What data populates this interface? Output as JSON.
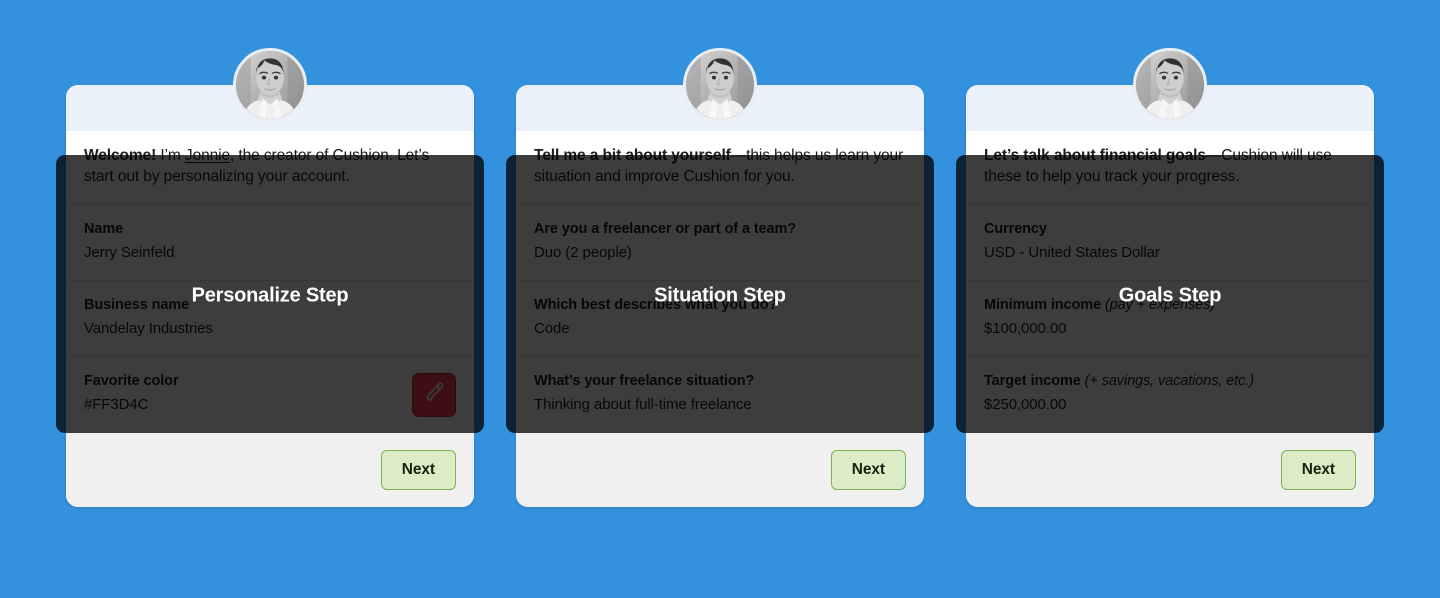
{
  "page": {
    "background_color": "#3391DE",
    "overlay_color": "rgba(0,0,0,0.76)",
    "accent_green": "#7CB254",
    "next_button_fill": "#DBECC7",
    "card_header_color": "#EAF1FA",
    "card_footer_color": "#F0F0F0",
    "overlay_panel_color": "#3C3C3C"
  },
  "cards": [
    {
      "step_label": "Personalize Step",
      "avatar_name": "jonnie-avatar",
      "intro": {
        "bold": "Welcome!",
        "before_link": " I’m ",
        "link": "Jonnie",
        "after_link": ", the creator of Cushion. Let’s start out by personalizing your account."
      },
      "fields": [
        {
          "label": "Name",
          "hint": "",
          "value": "Jerry Seinfeld",
          "swatch": null
        },
        {
          "label": "Business name",
          "hint": "",
          "value": "Vandelay Industries",
          "swatch": null
        },
        {
          "label": "Favorite color",
          "hint": "",
          "value": "#FF3D4C",
          "swatch": "#FF3D4C"
        }
      ],
      "next_label": "Next"
    },
    {
      "step_label": "Situation Step",
      "avatar_name": "jonnie-avatar",
      "intro": {
        "bold": "Tell me a bit about yourself",
        "before_link": "",
        "link": "",
        "after_link": "—this helps us learn your situation and improve Cushion for you."
      },
      "fields": [
        {
          "label": "Are you a freelancer or part of a team?",
          "hint": "",
          "value": "Duo (2 people)",
          "swatch": null
        },
        {
          "label": "Which best describes what you do?",
          "hint": "",
          "value": "Code",
          "swatch": null
        },
        {
          "label": "What’s your freelance situation?",
          "hint": "",
          "value": "Thinking about full-time freelance",
          "swatch": null
        }
      ],
      "next_label": "Next"
    },
    {
      "step_label": "Goals Step",
      "avatar_name": "jonnie-avatar",
      "intro": {
        "bold": "Let’s talk about financial goals",
        "before_link": "",
        "link": "",
        "after_link": "—Cushion will use these to help you track your progress."
      },
      "fields": [
        {
          "label": "Currency",
          "hint": "",
          "value": "USD - United States Dollar",
          "swatch": null
        },
        {
          "label": "Minimum income",
          "hint": "(pay + expenses)",
          "value": "$100,000.00",
          "swatch": null
        },
        {
          "label": "Target income",
          "hint": "(+ savings, vacations, etc.)",
          "value": "$250,000.00",
          "swatch": null
        }
      ],
      "next_label": "Next"
    }
  ],
  "icons": {
    "eyedropper": "eyedropper-icon"
  }
}
